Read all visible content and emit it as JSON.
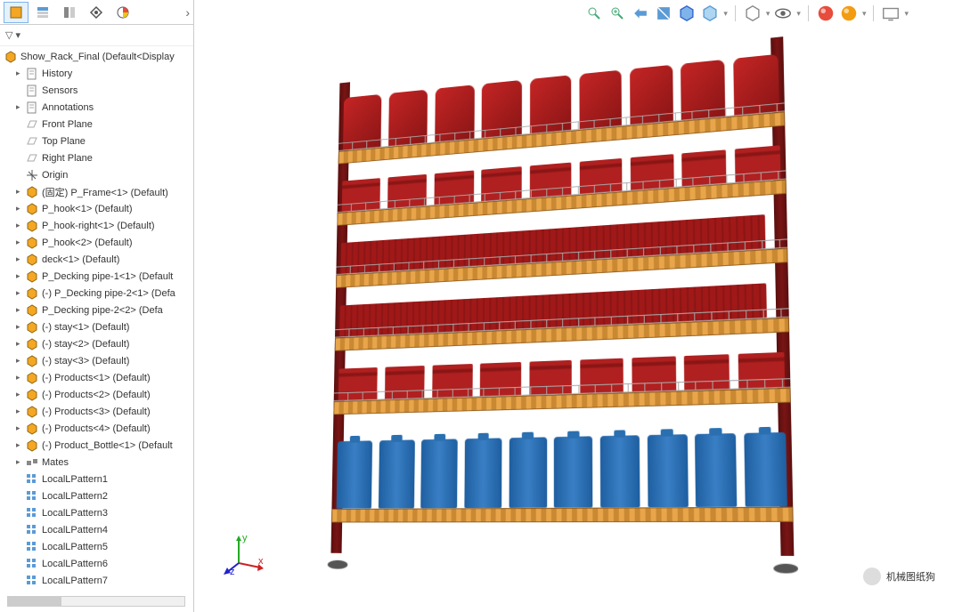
{
  "tree": {
    "root": "Show_Rack_Final  (Default<Display",
    "items": [
      {
        "icon": "paper",
        "label": "History",
        "arrow": "▸"
      },
      {
        "icon": "paper",
        "label": "Sensors"
      },
      {
        "icon": "paper",
        "label": "Annotations",
        "arrow": "▸"
      },
      {
        "icon": "plane",
        "label": "Front Plane"
      },
      {
        "icon": "plane",
        "label": "Top Plane"
      },
      {
        "icon": "plane",
        "label": "Right Plane"
      },
      {
        "icon": "origin",
        "label": "Origin"
      },
      {
        "icon": "part",
        "label": "(固定) P_Frame<1> (Default)",
        "arrow": "▸"
      },
      {
        "icon": "part",
        "label": "P_hook<1> (Default)",
        "arrow": "▸"
      },
      {
        "icon": "part",
        "label": "P_hook-right<1> (Default)",
        "arrow": "▸"
      },
      {
        "icon": "part",
        "label": "P_hook<2> (Default)",
        "arrow": "▸"
      },
      {
        "icon": "part",
        "label": "deck<1> (Default)",
        "arrow": "▸"
      },
      {
        "icon": "part",
        "label": "P_Decking pipe-1<1> (Default",
        "arrow": "▸"
      },
      {
        "icon": "part",
        "label": "(-) P_Decking pipe-2<1> (Defa",
        "arrow": "▸"
      },
      {
        "icon": "part",
        "label": "P_Decking pipe-2<2> (Defa",
        "arrow": "▸"
      },
      {
        "icon": "part",
        "label": "(-) stay<1> (Default)",
        "arrow": "▸"
      },
      {
        "icon": "part",
        "label": "(-) stay<2> (Default)",
        "arrow": "▸"
      },
      {
        "icon": "part",
        "label": "(-) stay<3> (Default)",
        "arrow": "▸"
      },
      {
        "icon": "part",
        "label": "(-) Products<1> (Default)",
        "arrow": "▸"
      },
      {
        "icon": "part",
        "label": "(-) Products<2> (Default)",
        "arrow": "▸"
      },
      {
        "icon": "part",
        "label": "(-) Products<3> (Default)",
        "arrow": "▸"
      },
      {
        "icon": "part",
        "label": "(-) Products<4> (Default)",
        "arrow": "▸"
      },
      {
        "icon": "part",
        "label": "(-) Product_Bottle<1> (Default",
        "arrow": "▸"
      },
      {
        "icon": "mate",
        "label": "Mates",
        "arrow": "▸"
      },
      {
        "icon": "pattern",
        "label": "LocalLPattern1"
      },
      {
        "icon": "pattern",
        "label": "LocalLPattern2"
      },
      {
        "icon": "pattern",
        "label": "LocalLPattern3"
      },
      {
        "icon": "pattern",
        "label": "LocalLPattern4"
      },
      {
        "icon": "pattern",
        "label": "LocalLPattern5"
      },
      {
        "icon": "pattern",
        "label": "LocalLPattern6"
      },
      {
        "icon": "pattern",
        "label": "LocalLPattern7"
      }
    ]
  },
  "watermark": "机械图纸狗",
  "triad": {
    "x": "x",
    "y": "y",
    "z": "z"
  }
}
